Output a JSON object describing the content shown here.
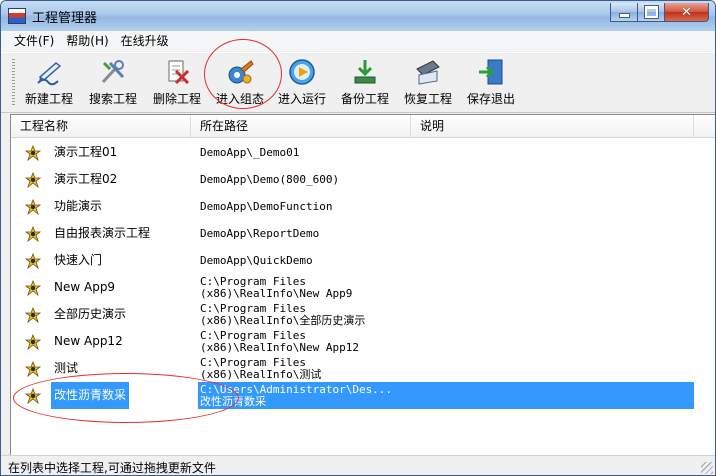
{
  "window": {
    "title": "工程管理器"
  },
  "menu": [
    "文件(F)",
    "帮助(H)",
    "在线升级"
  ],
  "toolbar": {
    "buttons": [
      {
        "label": "新建工程",
        "icon": "new-project-icon"
      },
      {
        "label": "搜索工程",
        "icon": "search-project-icon"
      },
      {
        "label": "删除工程",
        "icon": "delete-project-icon"
      },
      {
        "label": "进入组态",
        "icon": "configure-icon"
      },
      {
        "label": "进入运行",
        "icon": "run-icon"
      },
      {
        "label": "备份工程",
        "icon": "backup-icon"
      },
      {
        "label": "恢复工程",
        "icon": "restore-icon"
      },
      {
        "label": "保存退出",
        "icon": "save-exit-icon"
      }
    ]
  },
  "list": {
    "columns": [
      "工程名称",
      "所在路径",
      "说明"
    ],
    "rows": [
      {
        "name": "演示工程01",
        "path1": "DemoApp\\_Demo01",
        "path2": ""
      },
      {
        "name": "演示工程02",
        "path1": "DemoApp\\Demo(800_600)",
        "path2": ""
      },
      {
        "name": "功能演示",
        "path1": "DemoApp\\DemoFunction",
        "path2": ""
      },
      {
        "name": "自由报表演示工程",
        "path1": "DemoApp\\ReportDemo",
        "path2": ""
      },
      {
        "name": "快速入门",
        "path1": "DemoApp\\QuickDemo",
        "path2": ""
      },
      {
        "name": "New App9",
        "path1": "C:\\Program Files",
        "path2": "(x86)\\RealInfo\\New App9"
      },
      {
        "name": "全部历史演示",
        "path1": "C:\\Program Files",
        "path2": "(x86)\\RealInfo\\全部历史演示"
      },
      {
        "name": "New App12",
        "path1": "C:\\Program Files",
        "path2": "(x86)\\RealInfo\\New App12"
      },
      {
        "name": "测试",
        "path1": "C:\\Program Files",
        "path2": "(x86)\\RealInfo\\测试"
      },
      {
        "name": "改性沥青数采",
        "path1": "C:\\Users\\Administrator\\Des...",
        "path2": "改性沥青数采",
        "selected": true
      }
    ]
  },
  "status": {
    "text": "在列表中选择工程,可通过拖拽更新文件"
  },
  "colors": {
    "selection": "#3399ff",
    "annotation": "#e0312f"
  }
}
